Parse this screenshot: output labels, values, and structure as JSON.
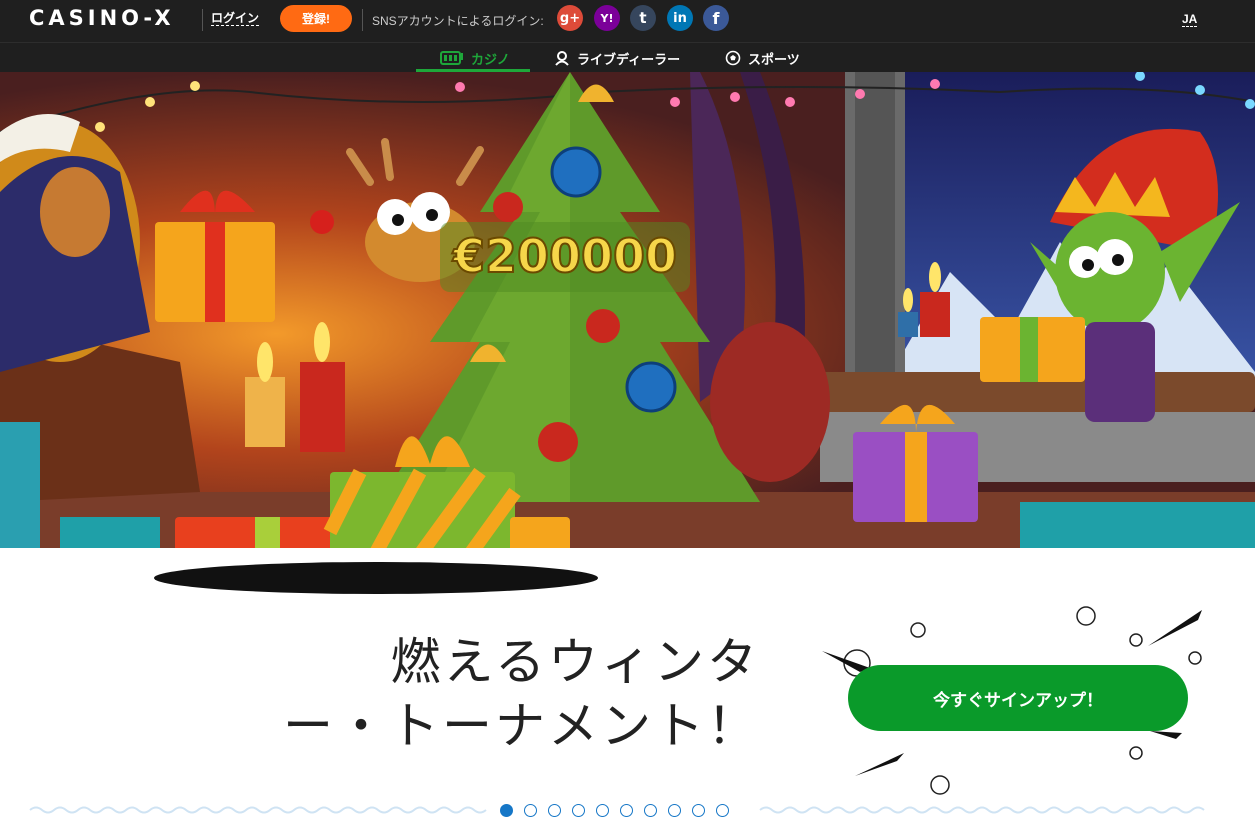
{
  "header": {
    "logo": "CASINO-X",
    "login_label": "ログイン",
    "register_label": "登録!",
    "sns_label": "SNSアカウントによるログイン:",
    "sns": [
      {
        "name": "google-plus",
        "glyph": "g+",
        "color": "#dd4b39"
      },
      {
        "name": "yahoo",
        "glyph": "Y!",
        "color": "#7b0099"
      },
      {
        "name": "tumblr",
        "glyph": "t",
        "color": "#36465d"
      },
      {
        "name": "linkedin",
        "glyph": "in",
        "color": "#0077b5"
      },
      {
        "name": "facebook",
        "glyph": "f",
        "color": "#3b5998"
      }
    ],
    "language": "JA"
  },
  "nav": {
    "tabs": [
      {
        "label": "カジノ",
        "icon": "slot-machine-icon",
        "active": true
      },
      {
        "label": "ライブディーラー",
        "icon": "dealer-icon",
        "active": false
      },
      {
        "label": "スポーツ",
        "icon": "soccer-ball-icon",
        "active": false
      }
    ]
  },
  "banner": {
    "prize": "€200000"
  },
  "promo": {
    "headline_line1": "燃えるウィンタ",
    "headline_line2": "ー・トーナメント！",
    "cta_label": "今すぐサインアップ！"
  },
  "slider": {
    "count": 10,
    "active_index": 0
  },
  "colors": {
    "accent_green": "#1ea73a",
    "cta_green": "#0a9a2a",
    "register_orange": "#ff6a13",
    "dot_blue": "#1677c7",
    "topbar": "#1f1f1f"
  }
}
